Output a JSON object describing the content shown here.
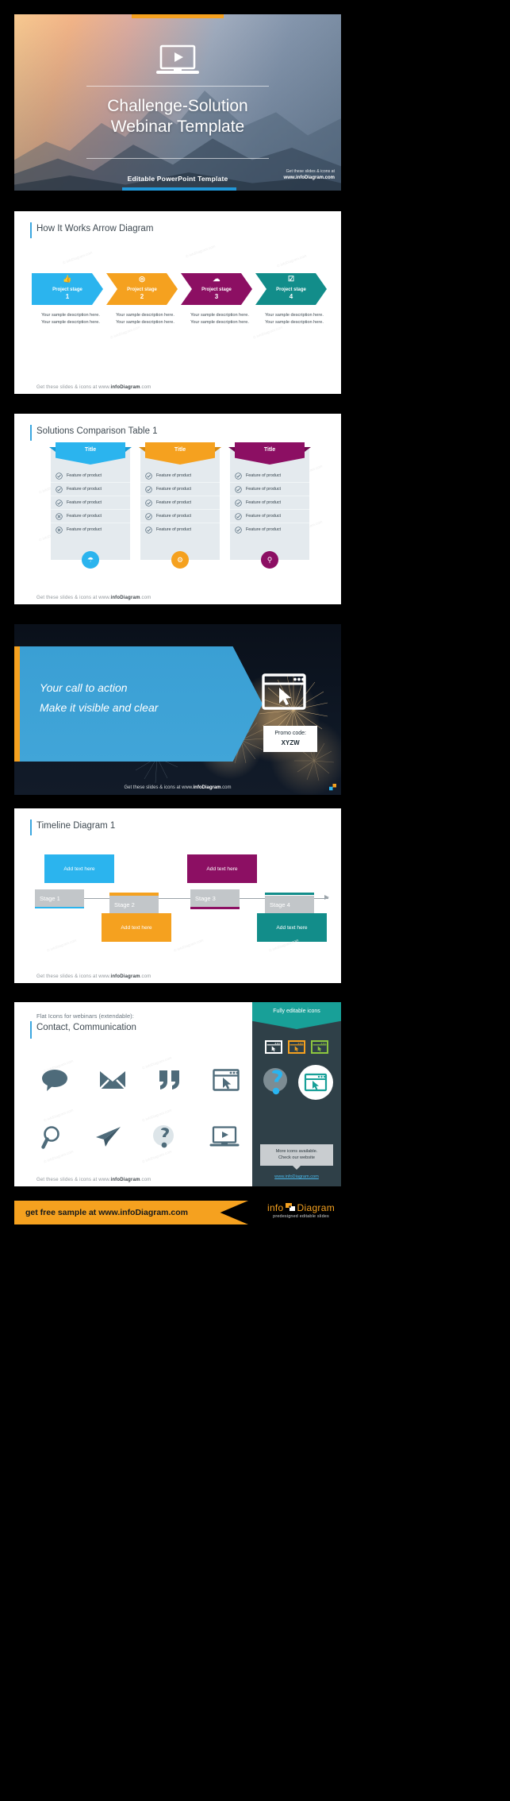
{
  "colors": {
    "blue": "#2bb4ee",
    "orange": "#f5a11f",
    "purple": "#8c0f63",
    "teal": "#128d8a",
    "slate": "#4e6b7a",
    "panel_dark": "#2f4048",
    "accent_link": "#49b7e8"
  },
  "footer_text": {
    "pre": "Get these slides & icons at www.",
    "brand": "infoDiagram",
    "post": ".com"
  },
  "watermark": "© infoDiagram.com",
  "slide1": {
    "name": "title-slide",
    "title_line1": "Challenge-Solution",
    "title_line2": "Webinar Template",
    "subtitle": "Editable PowerPoint Template",
    "footer_line1": "Get these slides & icons at",
    "footer_line2": "www.infoDiagram.com",
    "icon": "laptop-play-icon"
  },
  "slide2": {
    "name": "arrow-diagram-slide",
    "title": "How It Works Arrow Diagram",
    "stages": [
      {
        "label": "Project stage",
        "num": "1",
        "color": "#2bb4ee",
        "icon": "thumbs-up-icon",
        "glyph": "☝",
        "desc": "Your sample description here. Your sample description here."
      },
      {
        "label": "Project stage",
        "num": "2",
        "color": "#f5a11f",
        "icon": "location-pin-icon",
        "glyph": "◎",
        "desc": "Your sample description here. Your sample description here."
      },
      {
        "label": "Project stage",
        "num": "3",
        "color": "#8c0f63",
        "icon": "cloud-icon",
        "glyph": "☁",
        "desc": "Your sample description here. Your sample description here."
      },
      {
        "label": "Project stage",
        "num": "4",
        "color": "#128d8a",
        "icon": "checklist-icon",
        "glyph": "☑",
        "desc": "Your sample description here. Your sample description here."
      }
    ]
  },
  "slide3": {
    "name": "comparison-table-slide",
    "title": "Solutions Comparison Table 1",
    "columns": [
      {
        "title": "Title",
        "color": "#2bb4ee",
        "dark": "#1a9ad4",
        "badge_icon": "shield-icon",
        "badge_glyph": "⌂",
        "rows": [
          {
            "label": "Feature of product",
            "mark": "check"
          },
          {
            "label": "Feature of product",
            "mark": "check"
          },
          {
            "label": "Feature of product",
            "mark": "check"
          },
          {
            "label": "Feature of product",
            "mark": "cross"
          },
          {
            "label": "Feature of product",
            "mark": "cross"
          }
        ]
      },
      {
        "title": "Title",
        "color": "#f5a11f",
        "dark": "#d88a10",
        "badge_icon": "gear-icon",
        "badge_glyph": "⚙",
        "rows": [
          {
            "label": "Feature of product",
            "mark": "check"
          },
          {
            "label": "Feature of product",
            "mark": "check"
          },
          {
            "label": "Feature of product",
            "mark": "check"
          },
          {
            "label": "Feature of product",
            "mark": "check"
          },
          {
            "label": "Feature of product",
            "mark": "check"
          }
        ]
      },
      {
        "title": "Title",
        "color": "#8c0f63",
        "dark": "#6f0b4e",
        "badge_icon": "key-icon",
        "badge_glyph": "⚷",
        "rows": [
          {
            "label": "Feature of product",
            "mark": "check"
          },
          {
            "label": "Feature of product",
            "mark": "check"
          },
          {
            "label": "Feature of product",
            "mark": "check"
          },
          {
            "label": "Feature of product",
            "mark": "check"
          },
          {
            "label": "Feature of product",
            "mark": "check"
          }
        ]
      }
    ]
  },
  "slide4": {
    "name": "call-to-action-slide",
    "line1": "Your call to action",
    "line2": "Make it visible and clear",
    "promo_label": "Promo code:",
    "promo_code": "XYZW",
    "icon": "browser-cursor-icon"
  },
  "slide5": {
    "name": "timeline-slide",
    "title": "Timeline Diagram 1",
    "stages": [
      {
        "stage": "Stage 1",
        "text": "Add text here",
        "color": "#2bb4ee",
        "position": "above"
      },
      {
        "stage": "Stage 2",
        "text": "Add text here",
        "color": "#f5a11f",
        "position": "below"
      },
      {
        "stage": "Stage 3",
        "text": "Add text here",
        "color": "#8c0f63",
        "position": "above"
      },
      {
        "stage": "Stage 4",
        "text": "Add text here",
        "color": "#128d8a",
        "position": "below"
      }
    ]
  },
  "slide6": {
    "name": "flat-icons-slide",
    "title_small": "Flat Icons for webinars (extendable):",
    "title": "Contact, Communication",
    "icons_row1": [
      "speech-bubble-icon",
      "envelope-icon",
      "quotation-mark-icon",
      "browser-cursor-icon"
    ],
    "icons_row2": [
      "magnifier-icon",
      "paper-plane-icon",
      "question-mark-icon",
      "laptop-play-icon"
    ],
    "panel_header": "Fully editable icons",
    "panel_note_line1": "More icons available.",
    "panel_note_line2": "Check our website",
    "panel_link": "www.infoDiagram.com",
    "mini_icon_colors": [
      "#ffffff",
      "#f5a11f",
      "#8dc63f"
    ],
    "big_icon_left": "question-mark-icon",
    "big_icon_right": "browser-cursor-icon"
  },
  "banner": {
    "name": "bottom-banner",
    "cta": "get free sample at www.infoDiagram.com",
    "logo_part1": "info",
    "logo_part2": "Diagram",
    "tagline": "predesigned editable slides"
  }
}
